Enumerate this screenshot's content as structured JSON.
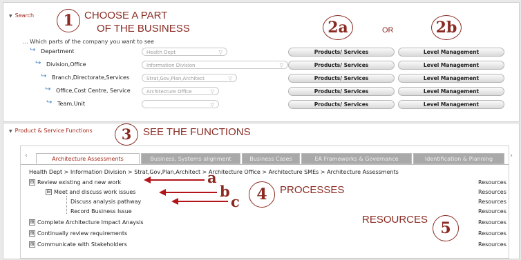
{
  "search": {
    "header": "Search",
    "hint": "... Which parts of the company you want to see",
    "rows": [
      {
        "label": "Department",
        "select": "Health Dept"
      },
      {
        "label": "Division,Office",
        "select": "Information Division"
      },
      {
        "label": "Branch,Directorate,Services",
        "select": "Strat,Gov,Plan,Architect"
      },
      {
        "label": "Office,Cost Centre, Service",
        "select": "Architecture Office"
      },
      {
        "label": "Team,Unit",
        "select": ""
      }
    ],
    "products_label": "Products/ Services",
    "level_label": "Level Management"
  },
  "functions": {
    "header": "Product & Service Functions",
    "tabs": [
      "Architecture Assessments",
      "Business, Systems alignment",
      "Business Cases",
      "EA Frameworks & Governance",
      "Identification & Planning"
    ],
    "breadcrumb": "Health Dept > Information Division > Strat,Gov,Plan,Architect > Architecture Office > Architecture SMEs > Architecture Assessments",
    "tree": [
      {
        "box": "⊟",
        "label": "Review existing and new work"
      },
      {
        "box": "⊟",
        "label": "Meet and discuss work issues"
      },
      {
        "box": "",
        "label": "Discuss analysis pathway"
      },
      {
        "box": "",
        "label": "Record Business Issue"
      },
      {
        "box": "⊞",
        "label": "Complete Architecture Impact Anaysis"
      },
      {
        "box": "⊞",
        "label": "Continually review requirements"
      },
      {
        "box": "⊞",
        "label": "Communicate with Stakeholders"
      }
    ],
    "resources_label": "Resources"
  },
  "annotations": {
    "n1": "1",
    "t1a": "CHOOSE A PART",
    "t1b": "OF THE BUSINESS",
    "n2a": "2a",
    "or": "OR",
    "n2b": "2b",
    "n3": "3",
    "t3": "SEE THE FUNCTIONS",
    "n4": "4",
    "t4": "PROCESSES",
    "n5": "5",
    "t5": "RESOURCES",
    "la": "a",
    "lb": "b",
    "lc": "c"
  },
  "colors": {
    "accent": "#a32a1c",
    "annotation": "#8a2a22",
    "arrow": "#b3141a",
    "link_icon": "#3f7fd0"
  }
}
